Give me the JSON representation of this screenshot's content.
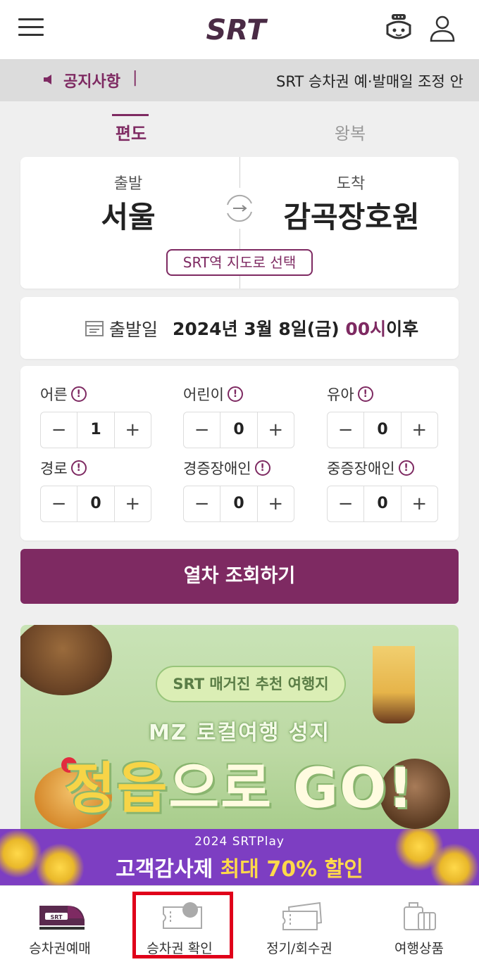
{
  "header": {
    "logo_text": "SRT",
    "menu_icon": "hamburger-menu-icon",
    "chatbot_icon": "robot-chatbot-icon",
    "user_icon": "user-icon"
  },
  "notice": {
    "label": "공지사항",
    "separator": "|",
    "text": "SRT 승차권 예·발매일 조정 안"
  },
  "tabs": {
    "oneway": "편도",
    "roundtrip": "왕복"
  },
  "route": {
    "departure_label": "출발",
    "departure_station": "서울",
    "arrival_label": "도착",
    "arrival_station": "감곡장호원",
    "map_button": "SRT역 지도로 선택"
  },
  "date": {
    "label": "출발일",
    "value": "2024년 3월 8일(금)",
    "hour": "00시",
    "suffix": "이후"
  },
  "passengers": [
    {
      "label": "어른",
      "value": "1"
    },
    {
      "label": "어린이",
      "value": "0"
    },
    {
      "label": "유아",
      "value": "0"
    },
    {
      "label": "경로",
      "value": "0"
    },
    {
      "label": "경증장애인",
      "value": "0"
    },
    {
      "label": "중증장애인",
      "value": "0"
    }
  ],
  "stepper": {
    "minus": "−",
    "plus": "+",
    "info": "!"
  },
  "search_button": "열차 조회하기",
  "banner": {
    "pill": "SRT 매거진 추천 여행지",
    "subtitle": "MZ 로컬여행 성지",
    "title_highlight": "정읍",
    "title_rest": "으로 GO!"
  },
  "promo": {
    "small": "2024 SRTPlay",
    "big_white": "고객감사제 ",
    "big_yellow": "최대 70% 할인"
  },
  "bottom_nav": [
    {
      "label": "승차권예매",
      "icon": "train-icon"
    },
    {
      "label": "승차권 확인",
      "icon": "ticket-check-icon"
    },
    {
      "label": "정기/회수권",
      "icon": "pass-ticket-icon"
    },
    {
      "label": "여행상품",
      "icon": "luggage-icon"
    }
  ],
  "colors": {
    "brand": "#7e2a62",
    "highlight_box": "#e0001a"
  }
}
